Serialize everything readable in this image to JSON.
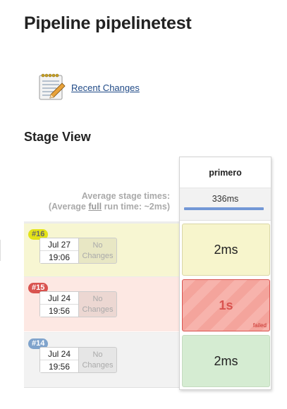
{
  "page": {
    "title": "Pipeline pipelinetest"
  },
  "recent_changes": {
    "label": "Recent Changes",
    "icon": "notepad-icon"
  },
  "stage_view": {
    "title": "Stage View",
    "avg_label_line1": "Average stage times:",
    "avg_full_prefix": "(Average ",
    "avg_full_word": "full",
    "avg_full_suffix": " run time: ~2ms)",
    "stages": [
      {
        "name": "primero",
        "avg_time": "336ms"
      }
    ],
    "builds": [
      {
        "number": "#16",
        "date": "Jul 27",
        "time": "19:06",
        "changes": [
          "No",
          "Changes"
        ],
        "stage_duration": "2ms",
        "status": "unstable",
        "status_color": "#f7f5cc"
      },
      {
        "number": "#15",
        "date": "Jul 24",
        "time": "19:56",
        "changes": [
          "No",
          "Changes"
        ],
        "stage_duration": "1s",
        "status": "failed",
        "status_label": "failed",
        "status_color": "#f4a49c"
      },
      {
        "number": "#14",
        "date": "Jul 24",
        "time": "19:56",
        "changes": [
          "No",
          "Changes"
        ],
        "stage_duration": "2ms",
        "status": "success",
        "status_color": "#d5ecd2"
      }
    ]
  },
  "colors": {
    "link": "#204a87",
    "failed": "#d9534f",
    "avg_bar": "#7398d6"
  }
}
